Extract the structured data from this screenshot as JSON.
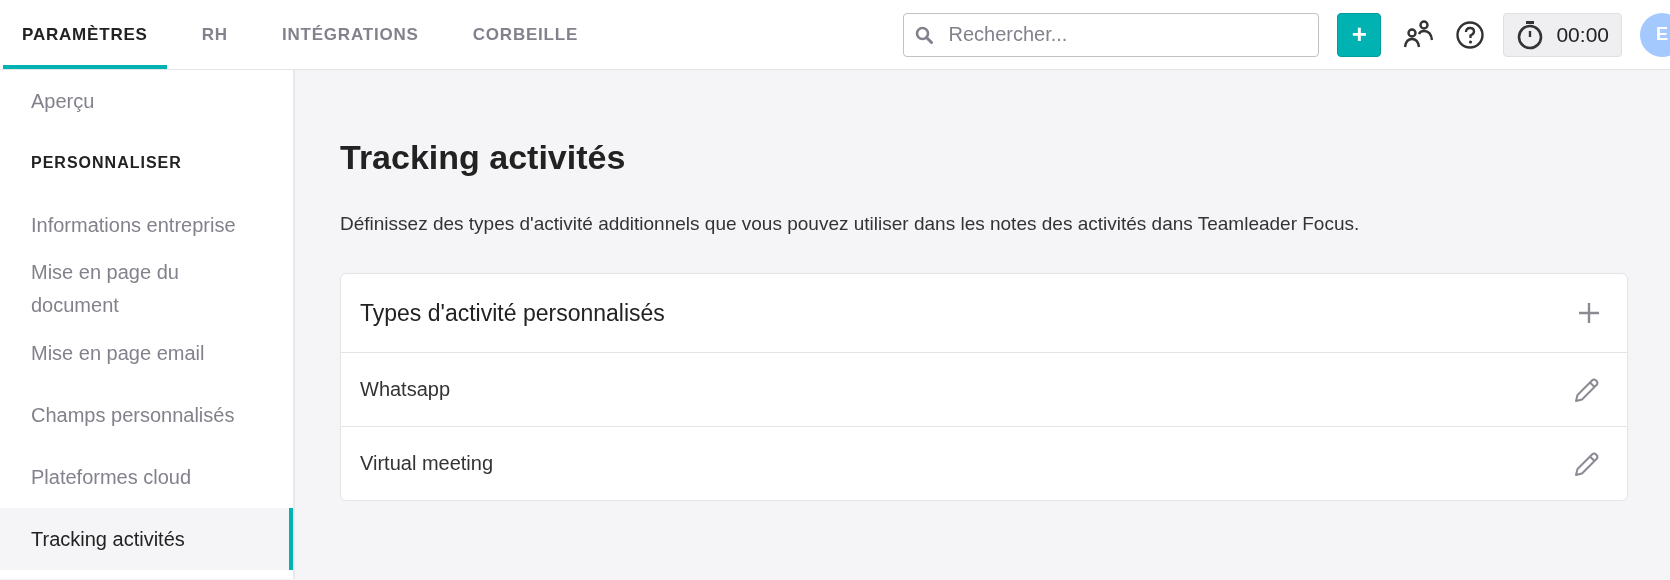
{
  "tabs": [
    {
      "label": "PARAMÈTRES",
      "selected": true
    },
    {
      "label": "RH",
      "selected": false
    },
    {
      "label": "INTÉGRATIONS",
      "selected": false
    },
    {
      "label": "CORBEILLE",
      "selected": false
    }
  ],
  "search": {
    "placeholder": "Rechercher..."
  },
  "add_button": {
    "label": "+"
  },
  "timer": {
    "value": "00:00"
  },
  "avatar": {
    "initial": "E"
  },
  "sidebar": {
    "items": [
      {
        "kind": "link",
        "label": "Aperçu",
        "selected": false
      },
      {
        "kind": "heading",
        "label": "PERSONNALISER"
      },
      {
        "kind": "link",
        "label": "Informations entreprise",
        "selected": false
      },
      {
        "kind": "link",
        "label": "Mise en page du document",
        "selected": false
      },
      {
        "kind": "link",
        "label": "Mise en page email",
        "selected": false
      },
      {
        "kind": "link",
        "label": "Champs personnalisés",
        "selected": false
      },
      {
        "kind": "link",
        "label": "Plateformes cloud",
        "selected": false
      },
      {
        "kind": "link",
        "label": "Tracking activités",
        "selected": true
      }
    ]
  },
  "page": {
    "title": "Tracking activités",
    "description": "Définissez des types d'activité additionnels que vous pouvez utiliser dans les notes des activités dans Teamleader Focus."
  },
  "card": {
    "title": "Types d'activité personnalisés",
    "rows": [
      {
        "label": "Whatsapp"
      },
      {
        "label": "Virtual meeting"
      }
    ]
  }
}
